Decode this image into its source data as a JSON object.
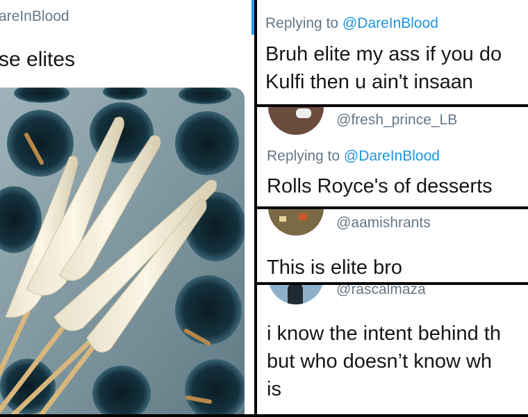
{
  "left_tweet": {
    "handle": "areInBlood",
    "text": "se elites",
    "image_alt": "kulfi-popsicles-in-mould-photo"
  },
  "replies": [
    {
      "avatar_icon": "user-avatar",
      "handle": "",
      "replying_label": "Replying to",
      "replying_to": "@DareInBlood",
      "lines": [
        "Bruh elite my ass if you do",
        "Kulfi then u ain't insaan"
      ]
    },
    {
      "avatar_icon": "user-avatar",
      "handle": "@fresh_prince_LB",
      "replying_label": "Replying to",
      "replying_to": "@DareInBlood",
      "lines": [
        "Rolls Royce's of desserts"
      ]
    },
    {
      "avatar_icon": "user-avatar",
      "handle": "@aamishrants",
      "lines": [
        "This is elite bro"
      ]
    },
    {
      "avatar_icon": "user-avatar",
      "handle": "@rascalmaza",
      "lines": [
        "i know the intent behind th",
        "but who doesn’t know wh",
        "is"
      ]
    }
  ],
  "colors": {
    "background": "#000000",
    "panel": "#ffffff",
    "muted_text": "#657786",
    "link": "#1b95e0",
    "main_text": "#14171a"
  }
}
